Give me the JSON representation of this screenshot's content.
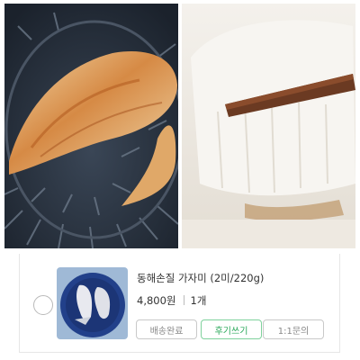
{
  "photos": {
    "left": {
      "subject": "pan-fried flounder on a grill pan"
    },
    "right": {
      "subject": "flounder flesh held with chopsticks"
    }
  },
  "order_item": {
    "product_name": "동해손질 가자미 (2미/220g)",
    "price": "4,800원",
    "quantity": "1개",
    "buttons": {
      "delivered": "배송완료",
      "review": "후기쓰기",
      "inquiry": "1:1문의"
    }
  },
  "colors": {
    "accent_green": "#2aa85a",
    "accent_green_border": "#7fd19c",
    "neutral_border": "#c9c9c9"
  }
}
